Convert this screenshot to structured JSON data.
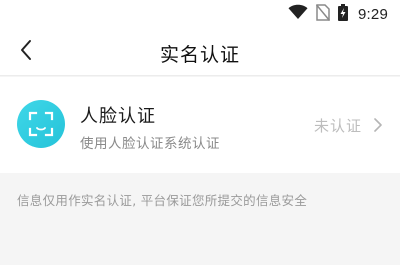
{
  "status_bar": {
    "time": "9:29",
    "icons": [
      "wifi-icon",
      "no-sim-icon",
      "battery-charging-icon"
    ]
  },
  "header": {
    "title": "实名认证",
    "back_icon": "back-arrow-icon"
  },
  "verify_item": {
    "icon": "face-scan-icon",
    "icon_color": "#2cc9dc",
    "title": "人脸认证",
    "subtitle": "使用人脸认证系统认证",
    "status": "未认证",
    "chevron_icon": "chevron-right-icon"
  },
  "notice": {
    "text": "信息仅用作实名认证, 平台保证您所提交的信息安全"
  }
}
